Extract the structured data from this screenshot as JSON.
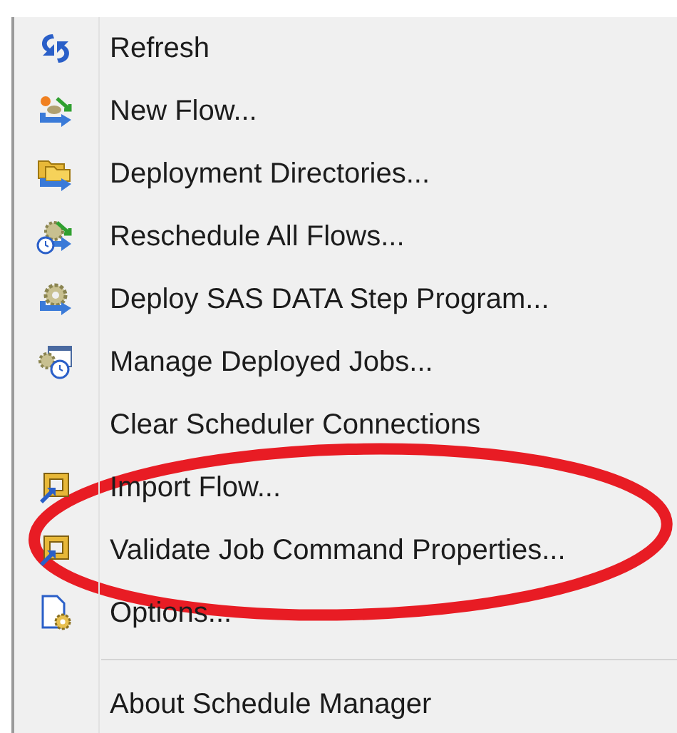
{
  "menu": {
    "items": [
      {
        "kind": "item",
        "label": "Refresh"
      },
      {
        "kind": "item",
        "label": "New Flow..."
      },
      {
        "kind": "item",
        "label": "Deployment Directories..."
      },
      {
        "kind": "item",
        "label": "Reschedule All Flows..."
      },
      {
        "kind": "item",
        "label": "Deploy SAS DATA Step Program..."
      },
      {
        "kind": "item",
        "label": "Manage Deployed Jobs..."
      },
      {
        "kind": "item",
        "label": "Clear Scheduler Connections"
      },
      {
        "kind": "item",
        "label": "Import Flow..."
      },
      {
        "kind": "item",
        "label": "Validate Job Command Properties..."
      },
      {
        "kind": "item",
        "label": "Options..."
      },
      {
        "kind": "separator"
      },
      {
        "kind": "item",
        "label": "About Schedule Manager"
      }
    ]
  }
}
